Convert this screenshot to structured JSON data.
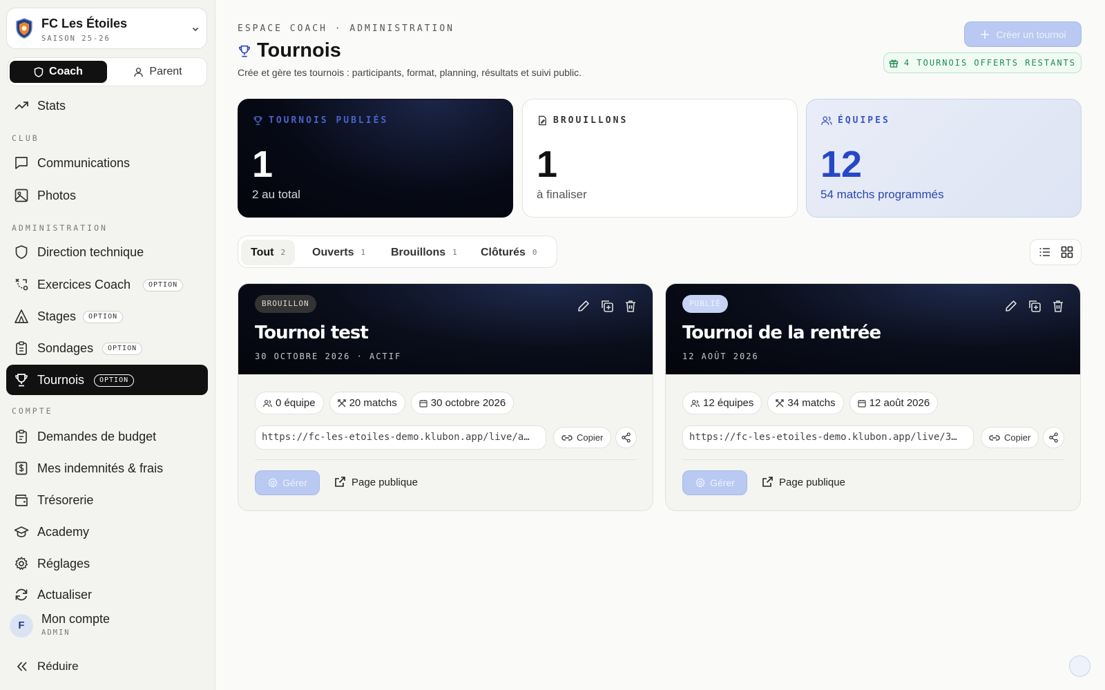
{
  "club": {
    "name": "FC Les Étoiles",
    "season": "SAISON 25-26"
  },
  "modes": {
    "coach": "Coach",
    "parent": "Parent"
  },
  "nav": {
    "stats": "Stats",
    "section_club": "CLUB",
    "communications": "Communications",
    "photos": "Photos",
    "section_admin": "ADMINISTRATION",
    "direction": "Direction technique",
    "exercices": "Exercices Coach",
    "stages": "Stages",
    "sondages": "Sondages",
    "tournois": "Tournois",
    "option_tag": "OPTION",
    "section_compte": "COMPTE",
    "budget": "Demandes de budget",
    "indemnites": "Mes indemnités & frais",
    "tresorerie": "Trésorerie",
    "academy": "Academy",
    "reglages": "Réglages",
    "actualiser": "Actualiser",
    "reduire": "Réduire"
  },
  "account": {
    "initial": "F",
    "name": "Mon compte",
    "role": "ADMIN"
  },
  "header": {
    "breadcrumb": "ESPACE COACH · ADMINISTRATION",
    "title": "Tournois",
    "subtitle": "Crée et gère tes tournois : participants, format, planning, résultats et suivi public.",
    "create_button": "Créer un tournoi",
    "offers_badge": "4 TOURNOIS OFFERTS RESTANTS"
  },
  "stats": [
    {
      "label": "TOURNOIS PUBLIÉS",
      "value": "1",
      "sub": "2 au total"
    },
    {
      "label": "BROUILLONS",
      "value": "1",
      "sub": "à finaliser"
    },
    {
      "label": "ÉQUIPES",
      "value": "12",
      "sub": "54 matchs programmés"
    }
  ],
  "tabs": [
    {
      "label": "Tout",
      "count": "2"
    },
    {
      "label": "Ouverts",
      "count": "1"
    },
    {
      "label": "Brouillons",
      "count": "1"
    },
    {
      "label": "Clôturés",
      "count": "0"
    }
  ],
  "cards": [
    {
      "status": "BROUILLON",
      "title": "Tournoi test",
      "date_line": "30 OCTOBRE 2026 · ACTIF",
      "teams": "0 équipe",
      "matches": "20 matchs",
      "date": "30 octobre 2026",
      "url": "https://fc-les-etoiles-demo.klubon.app/live/a…",
      "copy": "Copier",
      "manage": "Gérer",
      "public_page": "Page publique"
    },
    {
      "status": "PUBLIÉ",
      "title": "Tournoi de la rentrée",
      "date_line": "12 AOÛT 2026",
      "teams": "12 équipes",
      "matches": "34 matchs",
      "date": "12 août 2026",
      "url": "https://fc-les-etoiles-demo.klubon.app/live/3…",
      "copy": "Copier",
      "manage": "Gérer",
      "public_page": "Page publique"
    }
  ],
  "colors": {
    "accent": "#2647c8",
    "active_nav": "#111111",
    "primary_button": "#b9c9f1",
    "success": "#1f8b4c"
  }
}
